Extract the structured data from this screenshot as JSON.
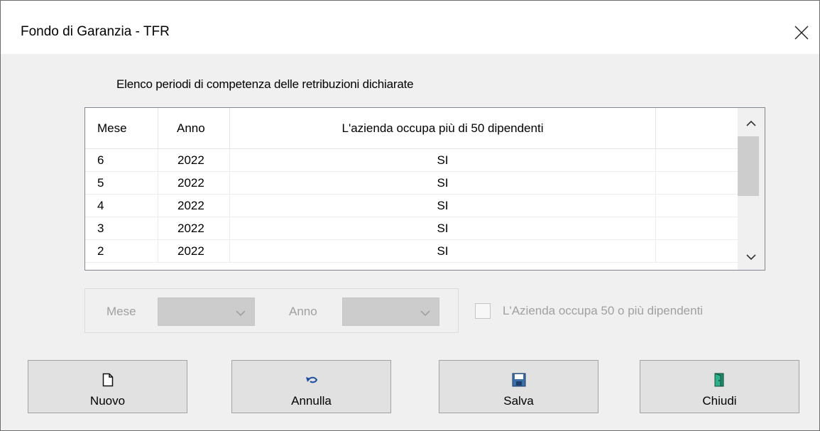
{
  "window": {
    "title": "Fondo di Garanzia - TFR",
    "close_icon": "close-icon"
  },
  "caption": "Elenco periodi di competenza delle retribuzioni dichiarate",
  "grid": {
    "columns": {
      "mese": "Mese",
      "anno": "Anno",
      "azienda": "L'azienda occupa più di 50 dipendenti",
      "extra": ""
    },
    "rows": [
      {
        "mese": "6",
        "anno": "2022",
        "azienda": "SI",
        "extra": ""
      },
      {
        "mese": "5",
        "anno": "2022",
        "azienda": "SI",
        "extra": ""
      },
      {
        "mese": "4",
        "anno": "2022",
        "azienda": "SI",
        "extra": ""
      },
      {
        "mese": "3",
        "anno": "2022",
        "azienda": "SI",
        "extra": ""
      },
      {
        "mese": "2",
        "anno": "2022",
        "azienda": "SI",
        "extra": ""
      }
    ]
  },
  "filters": {
    "mese_label": "Mese",
    "mese_value": "",
    "anno_label": "Anno",
    "anno_value": "",
    "checkbox_label": "L'Azienda occupa 50 o più dipendenti",
    "checkbox_checked": false
  },
  "buttons": {
    "nuovo": "Nuovo",
    "annulla": "Annulla",
    "salva": "Salva",
    "chiudi": "Chiudi"
  },
  "colors": {
    "window_bg": "#f0f0f0",
    "button_bg": "#e1e1e1",
    "disabled_text": "#a0a0a0",
    "save_icon": "#3c6ea8",
    "exit_icon": "#1f8a6b",
    "undo_icon": "#2050a0"
  }
}
